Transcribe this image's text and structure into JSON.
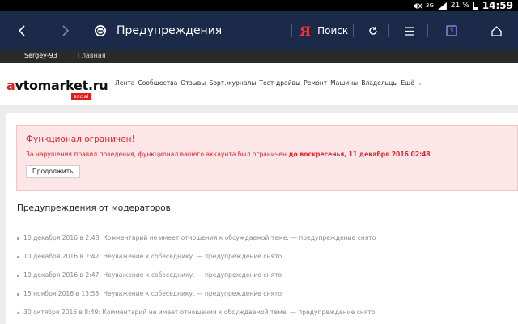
{
  "status_bar": {
    "network": "3G",
    "battery": "21 %",
    "time": "14:59",
    "icons": [
      "mute-icon",
      "signal-icon",
      "battery-icon"
    ]
  },
  "browser": {
    "title": "Предупреждения",
    "search_logo": "Я",
    "search_label": "Поиск",
    "tab_count": "3",
    "icons": [
      "back-icon",
      "forward-icon",
      "site-favicon",
      "refresh-icon",
      "menu-icon",
      "tabs-icon",
      "home-icon"
    ]
  },
  "site_bar": {
    "username": "Sergey-93",
    "home_link": "Главная"
  },
  "header": {
    "logo_red": "a",
    "logo_rest": "vtomarket.ru",
    "logo_badge": "social",
    "nav": [
      "Лента",
      "Сообщества",
      "Отзывы",
      "Борт.журналы",
      "Тест-драйвы",
      "Ремонт",
      "Машины",
      "Владельцы",
      "Ещё"
    ]
  },
  "alert": {
    "title": "Функционал ограничен!",
    "text_prefix": "За нарушения правил поведения, функционал вашего аккаунта был ограничен ",
    "text_bold": "до воскресенья, 11 декабря 2016 02:48",
    "text_suffix": ".",
    "button_label": "Продолжить",
    "colors": {
      "background": "#fde6e7",
      "text": "#e0262b"
    }
  },
  "warnings": {
    "title": "Предупреждения от модераторов",
    "items": [
      "10 декабря 2016 в 2:48: Комментарий не имеет отношения к обсуждаемой теме. — предупреждение снято",
      "10 декабря 2016 в 2:47: Неуважение к собеседнику. — предупреждение снято",
      "10 декабря 2016 в 2:47: Неуважение к собеседнику. — предупреждение снято",
      "15 ноября 2016 в 13:58: Неуважение к собеседнику. — предупреждение снято",
      "30 октября 2016 в 8:49: Комментарий не имеет отношения к обсуждаемой теме. — предупреждение снято"
    ]
  },
  "colors": {
    "toolbar": "#1c2a4a",
    "accent_red": "#e31c1c"
  }
}
